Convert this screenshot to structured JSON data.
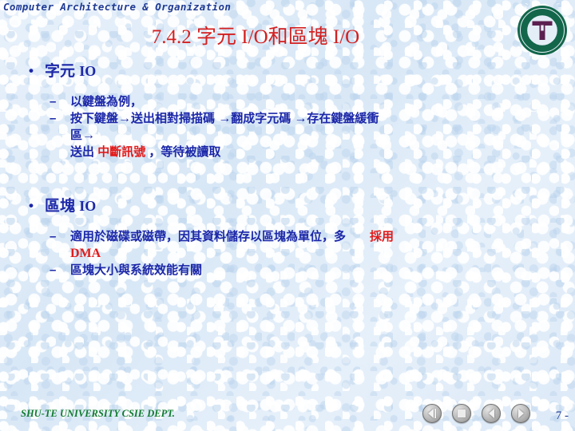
{
  "header": {
    "course": "Computer Architecture & Organization"
  },
  "title": "7.4.2 字元 I/O和區塊 I/O",
  "seal": {
    "name": "shu-te-university-seal",
    "ring_text": "SHU-TE UNIVERSITY",
    "monogram": "T",
    "ring_color": "#13664a",
    "monogram_color": "#5c2050"
  },
  "colors": {
    "heading_blue": "#1c27a8",
    "accent_red": "#e01b1b",
    "title_red": "#d42020",
    "footer_green": "#0f7a2e",
    "header_blue": "#1f3a93",
    "background": "#dfeaf7"
  },
  "content": {
    "sections": [
      {
        "bullet": "•",
        "heading_cjk": "字元",
        "heading_latin": "IO",
        "items": [
          {
            "dash": "–",
            "text": "以鍵盤為例，"
          },
          {
            "dash": "–",
            "line1_a": "按下鍵盤",
            "arrow1": "→",
            "line1_b": "送出相對掃描碼",
            "arrow2": "→",
            "line1_c": "翻成字元碼",
            "arrow3": "→",
            "line1_d": "存在鍵盤緩衝",
            "line2_a": "區",
            "arrow4": "→",
            "line3_a": "送出",
            "line3_red": "中斷訊號",
            "line3_b": "，等待被讀取"
          }
        ]
      },
      {
        "bullet": "•",
        "heading_cjk": "區塊",
        "heading_latin": "IO",
        "items": [
          {
            "dash": "–",
            "line1_a": "適用於磁碟或磁帶，因其資料儲存以區塊為單位，多",
            "line1_red": "採用",
            "line2_red": "DMA"
          },
          {
            "dash": "–",
            "text": "區塊大小與系統效能有關"
          }
        ]
      }
    ]
  },
  "footer": {
    "organization": "SHU-TE UNIVERSITY  CSIE DEPT.",
    "page_number": "7 -",
    "nav_buttons": [
      {
        "name": "previous-slide-button",
        "icon": "play-left-bar-icon"
      },
      {
        "name": "stop-button",
        "icon": "square-icon"
      },
      {
        "name": "back-button",
        "icon": "triangle-left-icon"
      },
      {
        "name": "forward-button",
        "icon": "triangle-right-icon"
      }
    ]
  }
}
